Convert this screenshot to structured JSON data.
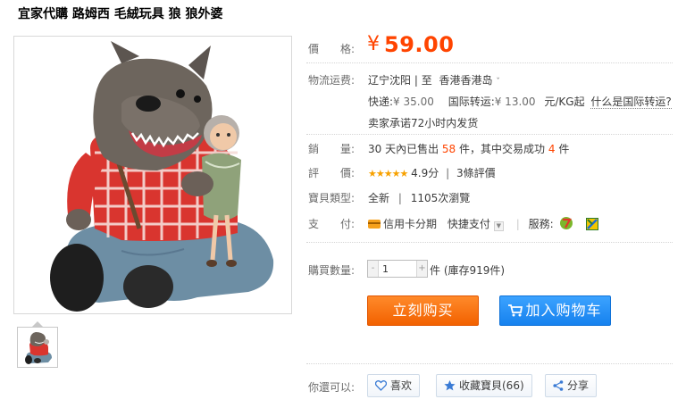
{
  "product": {
    "title": "宜家代購 路姆西 毛絨玩具 狼 狼外婆"
  },
  "price": {
    "label": "價　　格:",
    "currency": "¥",
    "value": "59.00"
  },
  "shipping": {
    "label": "物流运费:",
    "origin": "辽宁沈阳",
    "separator": "| 至",
    "destination": "香港香港岛",
    "express_label": "快递:",
    "express_price": "¥ 35.00",
    "intl_label": "国际转运:",
    "intl_price": "¥ 13.00",
    "intl_unit": "元/KG起",
    "intl_link": "什么是国际转运?",
    "promise": "卖家承诺72小时内发货"
  },
  "sales": {
    "label": "銷　　量:",
    "prefix": "30 天內已售出",
    "sold": "58",
    "middle": "件，其中交易成功",
    "success": "4",
    "suffix": "件"
  },
  "rating": {
    "label": "評　　價:",
    "stars": "★★★★★",
    "score": "4.9分",
    "separator": "|",
    "reviews": "3條評價"
  },
  "item_type": {
    "label": "寶貝類型:",
    "condition": "全新",
    "separator": "|",
    "views": "1105次瀏覽"
  },
  "payment": {
    "label": "支　　付:",
    "credit": "信用卡分期",
    "quick": "快捷支付",
    "service_label": "服務:"
  },
  "quantity": {
    "label": "購買數量:",
    "minus": "-",
    "value": "1",
    "plus": "+",
    "stock": "件 (庫存919件)"
  },
  "actions": {
    "buy_now": "立刻购买",
    "add_cart": "加入购物车"
  },
  "social": {
    "label": "你還可以:",
    "like": "喜欢",
    "favorite": "收藏寶貝(66)",
    "share": "分享"
  },
  "colors": {
    "price": "#ff4400",
    "buy_button": "#f26100",
    "cart_button": "#1681ee",
    "stars": "#f7a100"
  }
}
